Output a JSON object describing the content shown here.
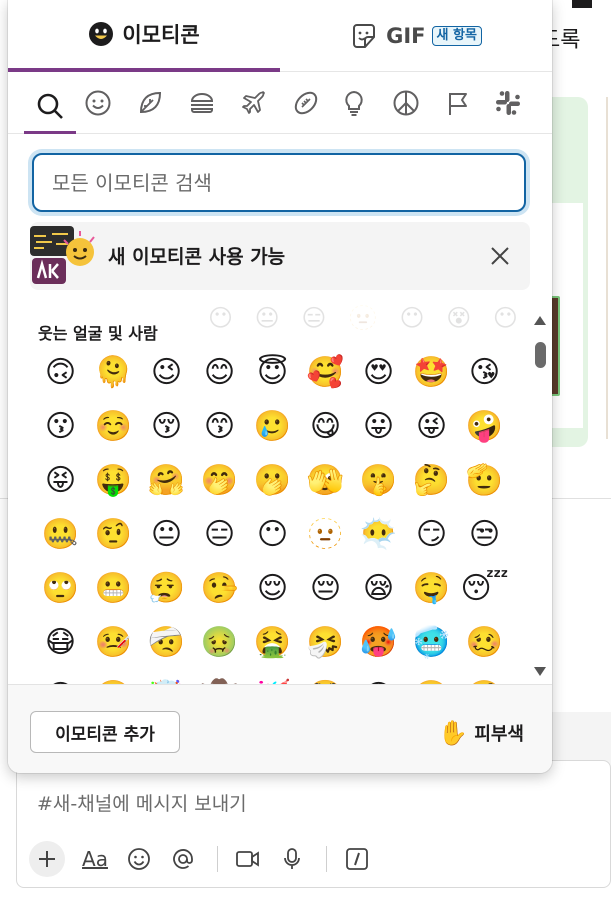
{
  "background": {
    "top_right_fragment": "도록",
    "composer": {
      "placeholder": "#새-채널에 메시지 보내기",
      "format_label": "Aa",
      "tools": [
        "plus-icon",
        "text-format-icon",
        "emoji-icon",
        "mention-icon",
        "video-icon",
        "microphone-icon",
        "slash-command-icon"
      ]
    }
  },
  "picker": {
    "tabs": [
      {
        "label": "이모티콘",
        "icon": "smiley-icon",
        "active": true
      },
      {
        "label": "GIF",
        "icon": "gif-sticker-icon",
        "badge": "새 항목",
        "active": false
      }
    ],
    "categories": [
      {
        "name": "search",
        "icon": "search-icon",
        "active": true
      },
      {
        "name": "smileys",
        "icon": "smiley-icon"
      },
      {
        "name": "nature",
        "icon": "leaf-icon"
      },
      {
        "name": "food",
        "icon": "burger-icon"
      },
      {
        "name": "travel",
        "icon": "airplane-icon"
      },
      {
        "name": "activities",
        "icon": "football-icon"
      },
      {
        "name": "objects",
        "icon": "lightbulb-icon"
      },
      {
        "name": "symbols",
        "icon": "peace-icon"
      },
      {
        "name": "flags",
        "icon": "flag-icon"
      },
      {
        "name": "custom",
        "icon": "slack-icon"
      }
    ],
    "search": {
      "placeholder": "모든 이모티콘 검색",
      "value": ""
    },
    "banner": {
      "text": "새 이모티콘 사용 가능"
    },
    "section_title": "웃는 얼굴 및 사람",
    "ghost_row": [
      "😶",
      "😐",
      "😑",
      "🫥",
      "😶",
      "😵",
      "😶"
    ],
    "emojis": [
      "🙃",
      "🫠",
      "😉",
      "😊",
      "😇",
      "🥰",
      "😍",
      "🤩",
      "😘",
      "😗",
      "☺️",
      "😚",
      "😙",
      "🥲",
      "😋",
      "😛",
      "😜",
      "🤪",
      "😝",
      "🤑",
      "🤗",
      "🤭",
      "🫢",
      "🫣",
      "🤫",
      "🤔",
      "🫡",
      "🤐",
      "🤨",
      "😐",
      "😑",
      "😶",
      "🫥",
      "😶‍🌫️",
      "😏",
      "😒",
      "🙄",
      "😬",
      "😮‍💨",
      "🤥",
      "😌",
      "😔",
      "😪",
      "🤤",
      "😴",
      "😷",
      "🤒",
      "🤕",
      "🤢",
      "🤮",
      "🤧",
      "🥵",
      "🥶",
      "🥴",
      "😵",
      "😵‍💫",
      "🤯",
      "🤠",
      "🥳",
      "🥸",
      "😎",
      "🤓",
      "🧐"
    ],
    "footer": {
      "add_label": "이모티콘 추가",
      "skin_tone_label": "피부색",
      "skin_tone_emoji": "✋"
    }
  },
  "colors": {
    "accent_purple": "#7b3a87",
    "focus_blue": "#1264a3",
    "badge_bg": "#e8f5fa"
  }
}
